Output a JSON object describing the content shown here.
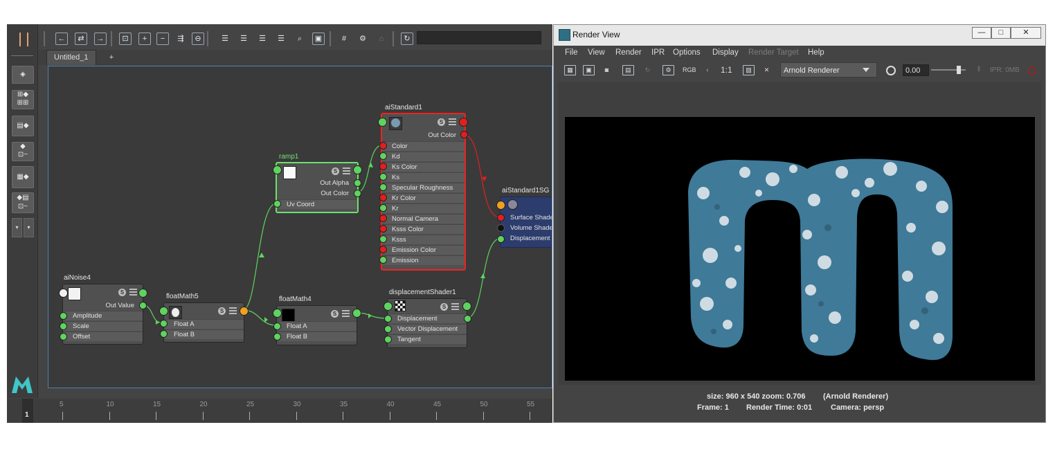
{
  "maya": {
    "tab_label": "Untitled_1",
    "add_tab_label": "+",
    "timeline": {
      "current_frame": "1",
      "ticks": [
        "5",
        "10",
        "15",
        "20",
        "25",
        "30",
        "35",
        "40",
        "45",
        "50",
        "55"
      ]
    },
    "logo_letter": "M"
  },
  "nodes": {
    "aiNoise4": {
      "title": "aiNoise4",
      "out": "Out Value",
      "attrs": [
        "Amplitude",
        "Scale",
        "Offset"
      ],
      "s": "S"
    },
    "floatMath5": {
      "title": "floatMath5",
      "attrs": [
        "Float A",
        "Float B"
      ],
      "s": "S"
    },
    "floatMath4": {
      "title": "floatMath4",
      "attrs": [
        "Float A",
        "Float B"
      ],
      "s": "S"
    },
    "ramp1": {
      "title": "ramp1",
      "outs": [
        "Out Alpha",
        "Out Color"
      ],
      "attrs": [
        "Uv Coord"
      ],
      "s": "S"
    },
    "aiStandard1": {
      "title": "aiStandard1",
      "out": "Out Color",
      "attrs": [
        "Color",
        "Kd",
        "Ks Color",
        "Ks",
        "Specular Roughness",
        "Kr Color",
        "Kr",
        "Normal Camera",
        "Ksss Color",
        "Ksss",
        "Emission Color",
        "Emission"
      ],
      "s": "S"
    },
    "displacementShader1": {
      "title": "displacementShader1",
      "attrs": [
        "Displacement",
        "Vector Displacement",
        "Tangent"
      ],
      "s": "S"
    },
    "aiStandard1SG": {
      "title": "aiStandard1SG",
      "attrs": [
        "Surface Shader",
        "Volume Shader",
        "Displacement S"
      ]
    }
  },
  "render_view": {
    "title": "Render View",
    "window_buttons": {
      "minimize": "—",
      "maximize": "□",
      "close": "✕"
    },
    "menu": [
      "File",
      "View",
      "Render",
      "IPR",
      "Options",
      "Display",
      "Render Target",
      "Help"
    ],
    "toolbar": {
      "rgb_label": "RGB",
      "ratio_label": "1:1",
      "renderer": "Arnold Renderer",
      "exposure": "0.00",
      "ipr_label": "IPR: 0MB"
    },
    "status": {
      "size_zoom": "size: 960 x 540 zoom: 0.706",
      "renderer": "(Arnold Renderer)",
      "frame": "Frame: 1",
      "render_time": "Render Time: 0:01",
      "camera": "Camera: persp"
    }
  },
  "colors": {
    "accent_blue": "#4e7fb0",
    "port_green": "#5fd35f",
    "port_red": "#e02020",
    "port_orange": "#f0a020",
    "render_blue": "#3f7a98",
    "selection_red": "#e22222",
    "selection_green": "#6ee26e"
  }
}
